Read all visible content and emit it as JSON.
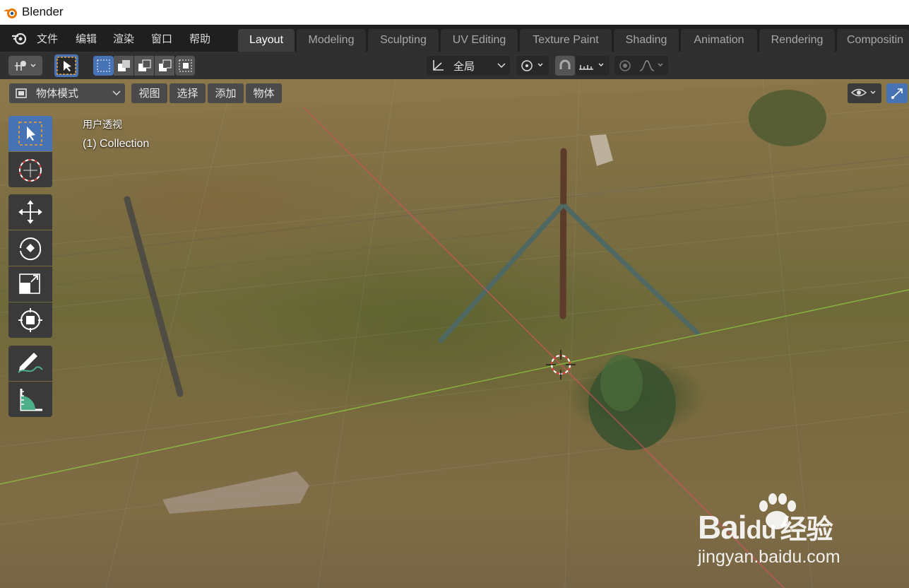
{
  "window": {
    "title": "Blender"
  },
  "menu": [
    "文件",
    "编辑",
    "渲染",
    "窗口",
    "帮助"
  ],
  "workspace_tabs": [
    "Layout",
    "Modeling",
    "Sculpting",
    "UV Editing",
    "Texture Paint",
    "Shading",
    "Animation",
    "Rendering",
    "Compositin"
  ],
  "active_tab": "Layout",
  "tool_header": {
    "orientation": "全局"
  },
  "viewport_header": {
    "mode": "物体模式",
    "menus": [
      "视图",
      "选择",
      "添加",
      "物体"
    ]
  },
  "viewport": {
    "view_name": "用户透视",
    "collection": "(1) Collection"
  },
  "tools": [
    "select-box",
    "cursor",
    "move",
    "rotate",
    "scale",
    "transform",
    "annotate",
    "measure"
  ],
  "watermark": {
    "brand": "Bai",
    "brand2": "du",
    "cn": "经验",
    "url": "jingyan.baidu.com"
  },
  "colors": {
    "accent": "#4772b3",
    "active_tool": "#4772b3",
    "x_axis": "#d0525a",
    "y_axis": "#8cc63f"
  }
}
